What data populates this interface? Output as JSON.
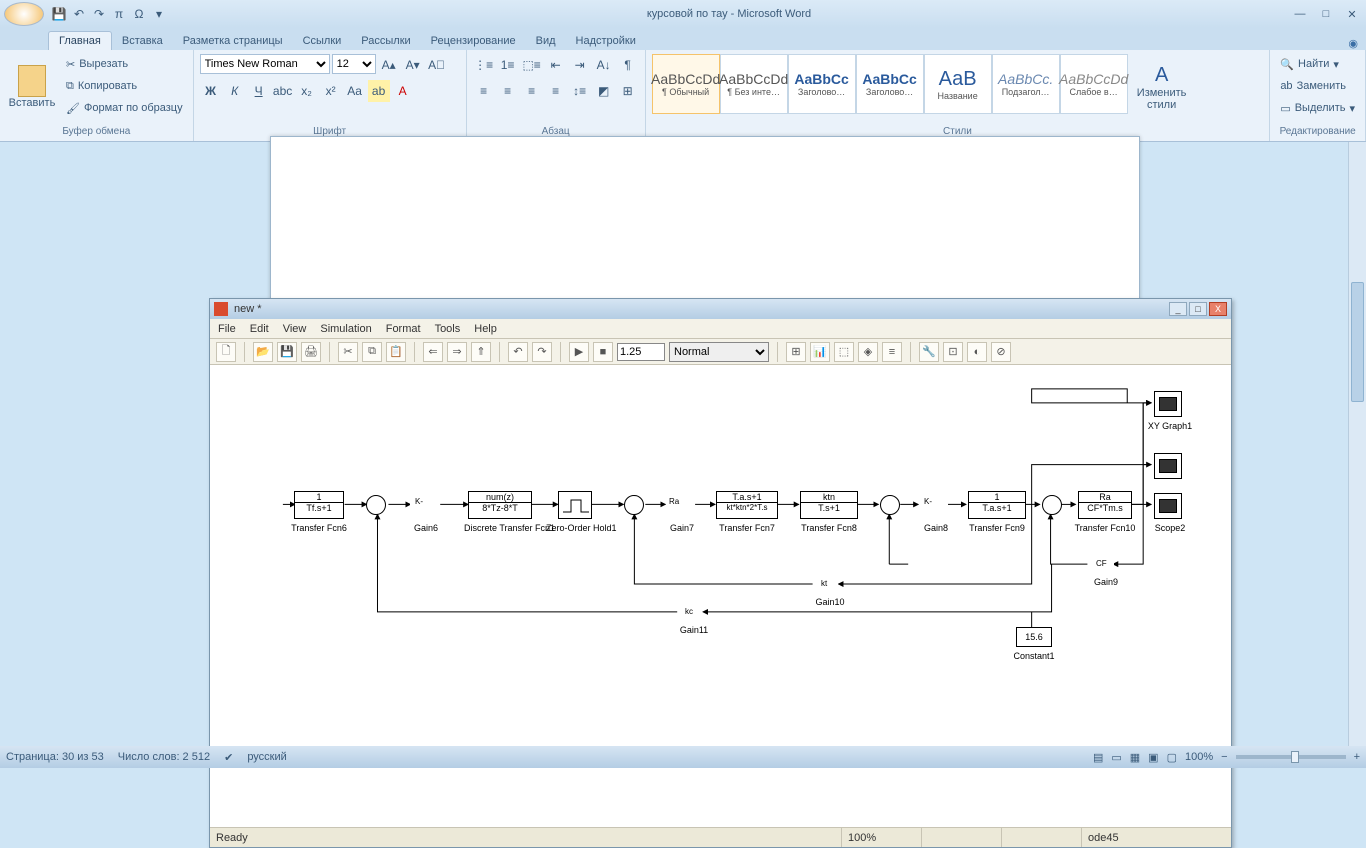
{
  "word": {
    "title": "курсовой по тау - Microsoft Word",
    "qat_items": [
      "💾",
      "↶",
      "↷",
      "π",
      "Ω",
      "▾"
    ],
    "tabs": [
      "Главная",
      "Вставка",
      "Разметка страницы",
      "Ссылки",
      "Рассылки",
      "Рецензирование",
      "Вид",
      "Надстройки"
    ],
    "active_tab": 0,
    "clipboard": {
      "paste": "Вставить",
      "cut": "Вырезать",
      "copy": "Копировать",
      "fmt": "Формат по образцу",
      "label": "Буфер обмена"
    },
    "font": {
      "name": "Times New Roman",
      "size": "12",
      "label": "Шрифт"
    },
    "para": {
      "label": "Абзац"
    },
    "styles": {
      "label": "Стили",
      "items": [
        {
          "sample": "AaBbCcDd",
          "name": "¶ Обычный"
        },
        {
          "sample": "AaBbCcDd",
          "name": "¶ Без инте…"
        },
        {
          "sample": "AaBbCc",
          "name": "Заголово…"
        },
        {
          "sample": "AaBbCc",
          "name": "Заголово…"
        },
        {
          "sample": "АаВ",
          "name": "Название"
        },
        {
          "sample": "AaBbCc.",
          "name": "Подзагол…"
        },
        {
          "sample": "AaBbCcDd",
          "name": "Слабое в…"
        }
      ],
      "change": "Изменить стили"
    },
    "editing": {
      "find": "Найти",
      "replace": "Заменить",
      "select": "Выделить",
      "label": "Редактирование"
    },
    "status": {
      "page": "Страница: 30 из 53",
      "words": "Число слов: 2 512",
      "lang": "русский",
      "zoom": "100%"
    }
  },
  "sim": {
    "title": "new *",
    "menu": [
      "File",
      "Edit",
      "View",
      "Simulation",
      "Format",
      "Tools",
      "Help"
    ],
    "stoptime": "1.25",
    "mode": "Normal",
    "status": {
      "ready": "Ready",
      "pct": "100%",
      "solver": "ode45"
    },
    "blocks": {
      "tf6": {
        "num": "1",
        "den": "Tf.s+1",
        "label": "Transfer Fcn6"
      },
      "gain6": {
        "k": "K-",
        "label": "Gain6"
      },
      "dtf1": {
        "num": "num(z)",
        "den": "8*Tz-8*T",
        "label": "Discrete Transfer Fcn1"
      },
      "zoh": {
        "label": "Zero-Order Hold1"
      },
      "gain7": {
        "k": "Ra",
        "label": "Gain7"
      },
      "tf7": {
        "num": "T.a.s+1",
        "den": "kt*ktn*2*T.s",
        "label": "Transfer Fcn7"
      },
      "tf8": {
        "num": "ktn",
        "den": "T.s+1",
        "label": "Transfer Fcn8"
      },
      "gain8": {
        "k": "K-",
        "label": "Gain8"
      },
      "tf9": {
        "num": "1",
        "den": "T.a.s+1",
        "label": "Transfer Fcn9"
      },
      "tf10": {
        "num": "Ra",
        "den": "CF*Tm.s",
        "label": "Transfer Fcn10"
      },
      "gain9": {
        "k": "CF",
        "label": "Gain9"
      },
      "gain10": {
        "k": "kt",
        "label": "Gain10"
      },
      "gain11": {
        "k": "kc",
        "label": "Gain11"
      },
      "const1": {
        "val": "15.6",
        "label": "Constant1"
      },
      "xy": {
        "label": "XY Graph1"
      },
      "scope2": {
        "label": "Scope2"
      }
    }
  }
}
